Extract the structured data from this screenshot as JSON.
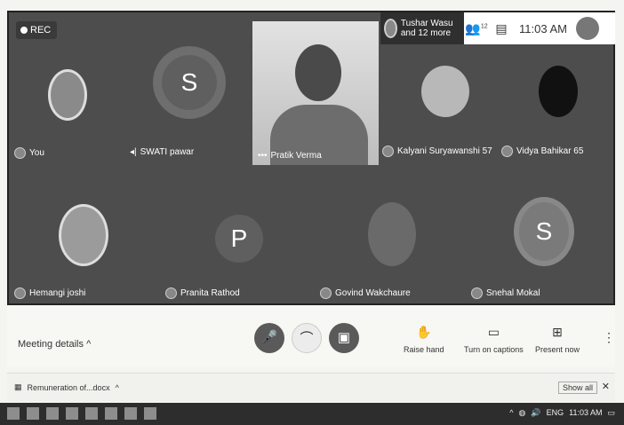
{
  "meeting": {
    "rec_label": "REC",
    "participants_pill": "Tushar Wasu and 12 more",
    "participants_count": "12",
    "time": "11:03 AM"
  },
  "participants": [
    {
      "name": "You",
      "type": "photo"
    },
    {
      "name": "SWATI pawar",
      "type": "letter",
      "letter": "S",
      "bg": "#5f5f5f"
    },
    {
      "name": "Pratik Verma",
      "type": "video"
    },
    {
      "name": "Kalyani Suryawanshi 57",
      "type": "photo"
    },
    {
      "name": "Vidya Bahikar 65",
      "type": "dark"
    },
    {
      "name": "Hemangi joshi",
      "type": "photo"
    },
    {
      "name": "Pranita Rathod",
      "type": "letter",
      "letter": "P",
      "bg": "#5f5f5f"
    },
    {
      "name": "Govind Wakchaure",
      "type": "photo"
    },
    {
      "name": "Snehal Mokal",
      "type": "letter",
      "letter": "S",
      "bg": "#7a7a7a"
    }
  ],
  "controls": {
    "meeting_details": "Meeting details",
    "raise_hand": "Raise hand",
    "captions": "Turn on captions",
    "present": "Present now"
  },
  "downloads": {
    "file": "Remuneration of...docx",
    "show_all": "Show all"
  },
  "taskbar": {
    "lang": "ENG",
    "time": "11:03 AM"
  }
}
